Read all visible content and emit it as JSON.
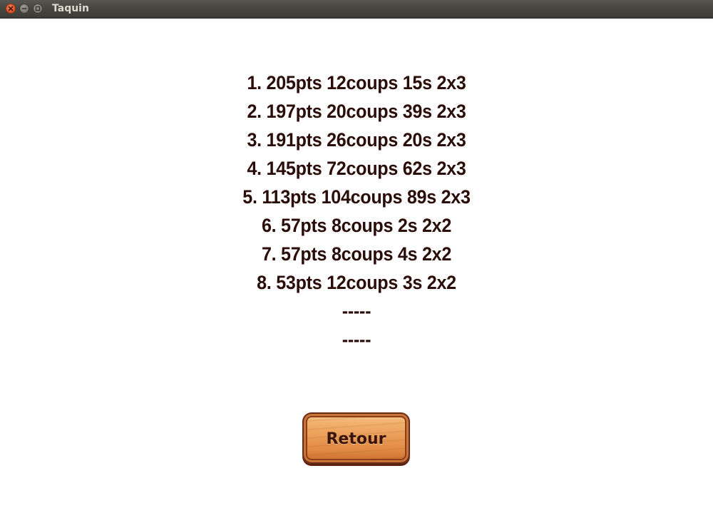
{
  "window": {
    "title": "Taquin",
    "buttons": {
      "close_icon": "close-icon",
      "minimize_icon": "minimize-icon",
      "maximize_icon": "maximize-icon"
    }
  },
  "scores": [
    "1. 205pts 12coups 15s 2x3",
    "2. 197pts 20coups 39s 2x3",
    "3. 191pts 26coups 20s 2x3",
    "4. 145pts 72coups 62s 2x3",
    "5. 113pts 104coups 89s 2x3",
    "6. 57pts 8coups 2s 2x2",
    "7. 57pts 8coups 4s 2x2",
    "8. 53pts 12coups 3s 2x2",
    "-----",
    "-----"
  ],
  "actions": {
    "back_label": "Retour"
  },
  "colors": {
    "score_text": "#2a0d08",
    "titlebar": "#3c3b37",
    "button_wood": "#eda25d"
  }
}
